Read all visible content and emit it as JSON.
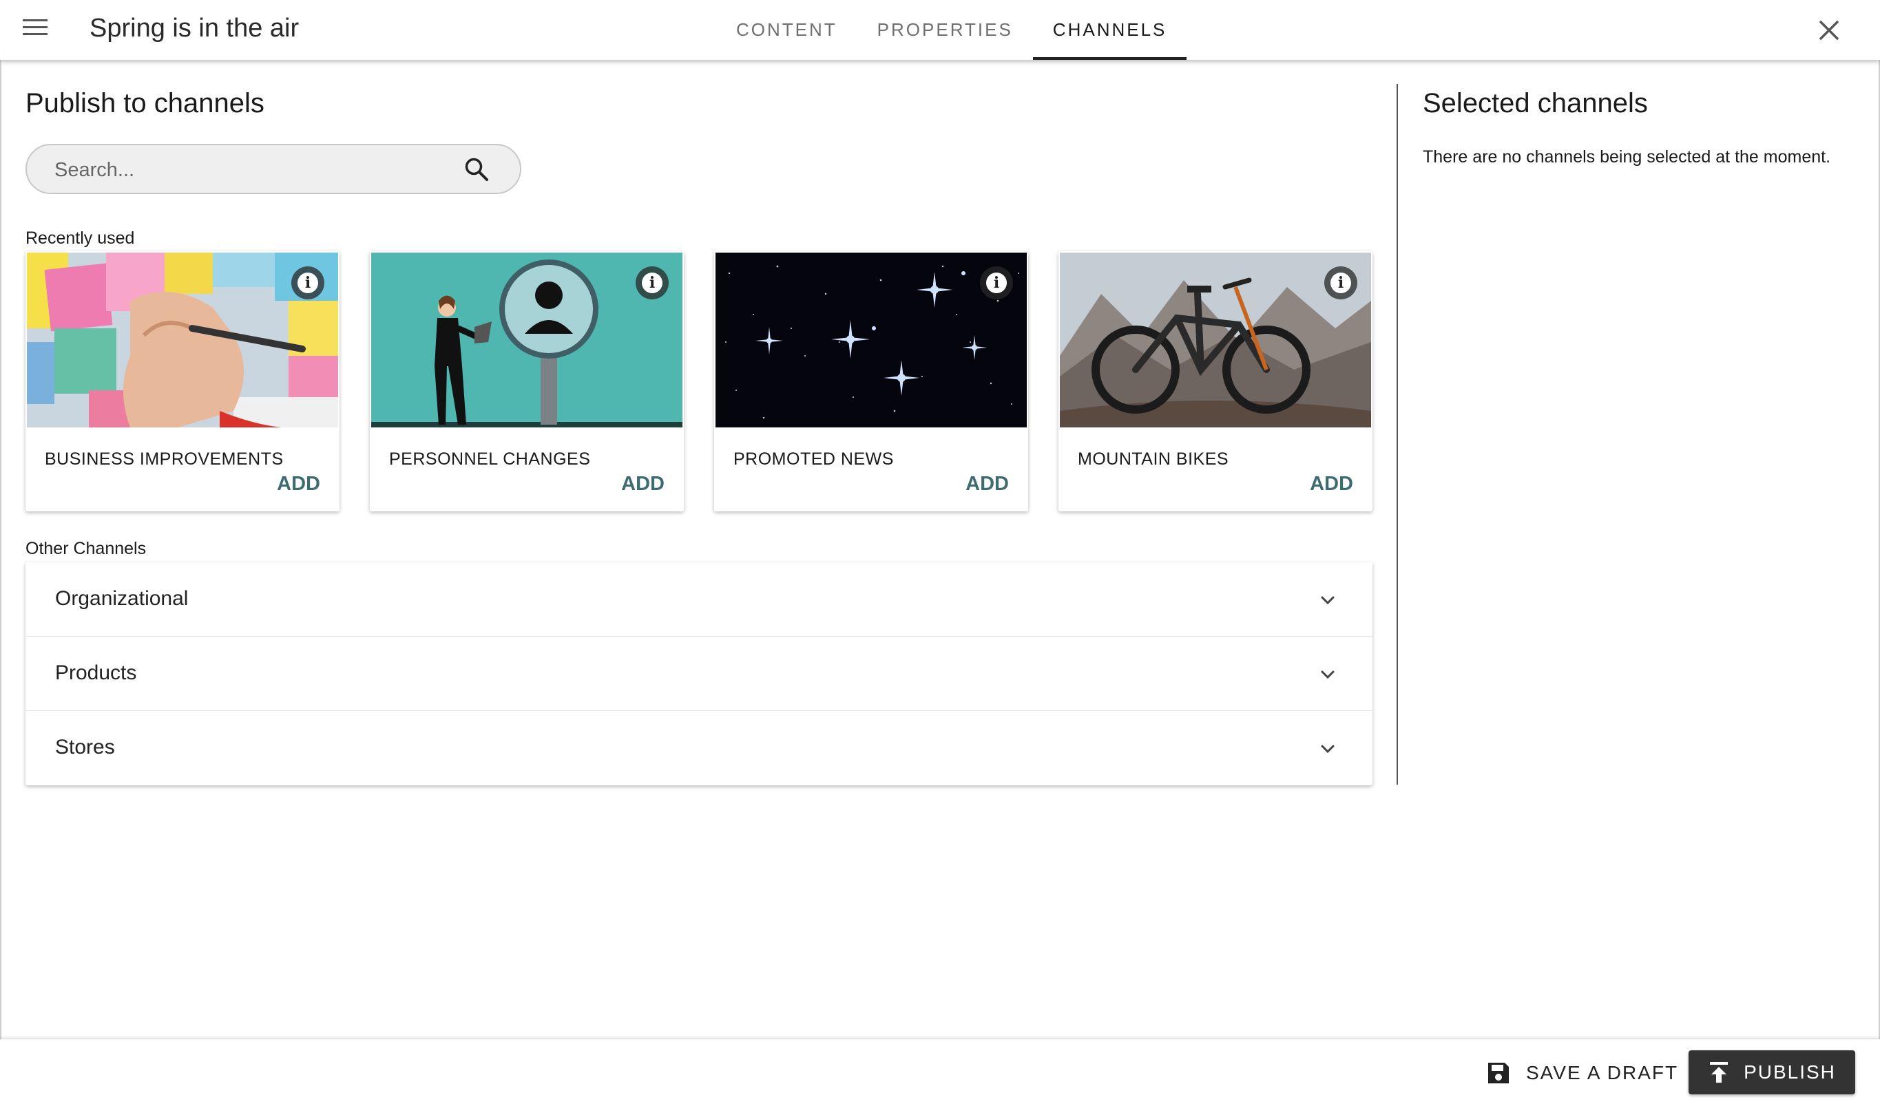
{
  "header": {
    "title": "Spring is in the air",
    "tabs": [
      {
        "label": "CONTENT",
        "active": false
      },
      {
        "label": "PROPERTIES",
        "active": false
      },
      {
        "label": "CHANNELS",
        "active": true
      }
    ],
    "menu_icon": "hamburger-menu-icon",
    "close_icon": "close-icon"
  },
  "publish": {
    "title": "Publish to channels",
    "search_placeholder": "Search...",
    "search_icon": "search-icon",
    "recently_used_label": "Recently used",
    "recent_channels": [
      {
        "name": "BUSINESS IMPROVEMENTS",
        "add_label": "ADD",
        "image": "sticky-notes-photo"
      },
      {
        "name": "PERSONNEL CHANGES",
        "add_label": "ADD",
        "image": "businesswoman-magnifier-illustration"
      },
      {
        "name": "PROMOTED NEWS",
        "add_label": "ADD",
        "image": "star-cluster-photo"
      },
      {
        "name": "MOUNTAIN BIKES",
        "add_label": "ADD",
        "image": "mountain-bike-photo"
      }
    ],
    "other_channels_label": "Other Channels",
    "groups": [
      {
        "label": "Organizational"
      },
      {
        "label": "Products"
      },
      {
        "label": "Stores"
      }
    ]
  },
  "selected": {
    "title": "Selected channels",
    "empty_text": "There are no channels being selected at the moment."
  },
  "footer": {
    "save_draft_label": "SAVE A DRAFT",
    "publish_label": "PUBLISH"
  },
  "colors": {
    "accent": "#3d6b6f",
    "primary_button": "#333333",
    "teal_illustration": "#4fb6b0"
  }
}
